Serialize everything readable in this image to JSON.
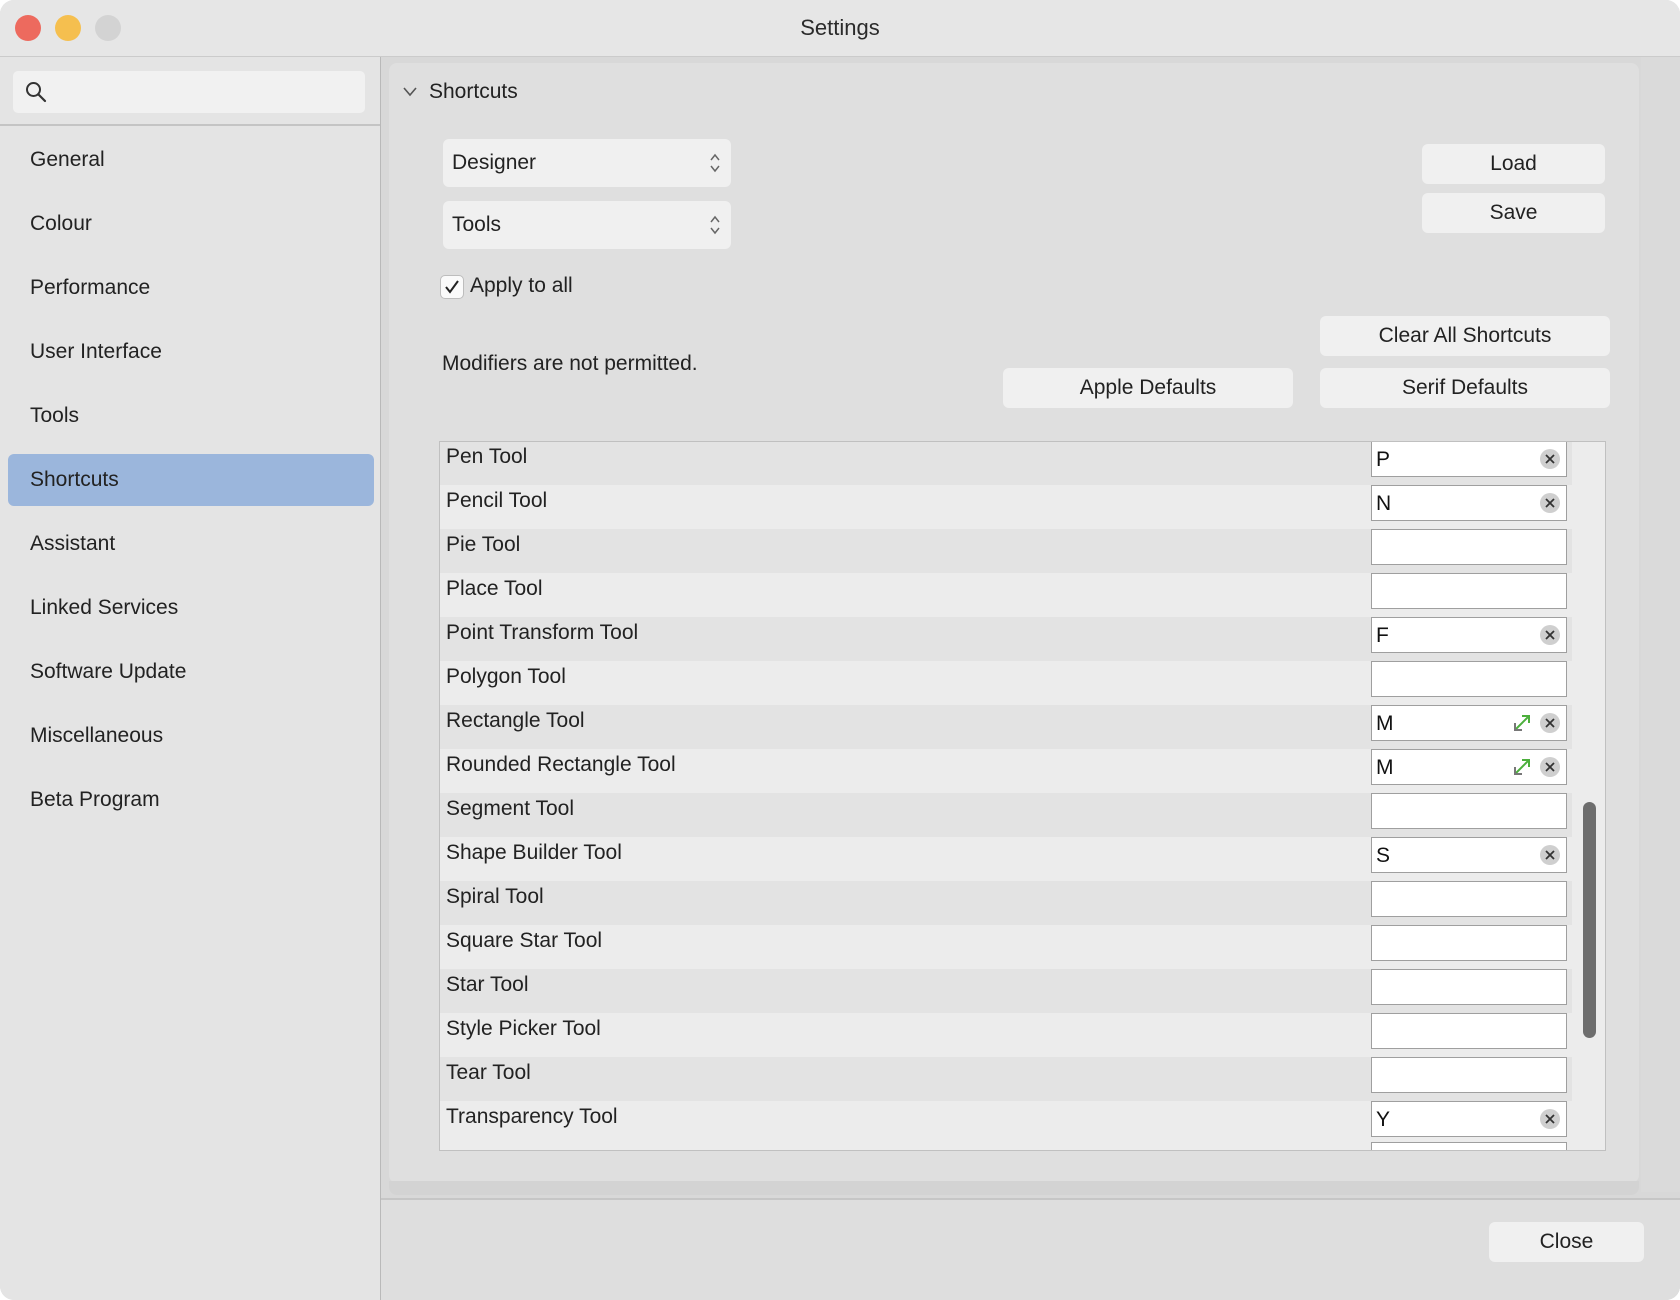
{
  "window": {
    "title": "Settings",
    "traffic_lights": {
      "close_color": "#ed6a5e",
      "minimize_color": "#f5bf4f",
      "zoom_color": "#d3d3d3"
    }
  },
  "sidebar": {
    "search": {
      "icon": "magnifier-icon",
      "value": "",
      "placeholder": ""
    },
    "selected_color": "#9bb6dc",
    "items": [
      {
        "label": "General"
      },
      {
        "label": "Colour"
      },
      {
        "label": "Performance"
      },
      {
        "label": "User Interface"
      },
      {
        "label": "Tools"
      },
      {
        "label": "Shortcuts",
        "selected": true
      },
      {
        "label": "Assistant"
      },
      {
        "label": "Linked Services"
      },
      {
        "label": "Software Update"
      },
      {
        "label": "Miscellaneous"
      },
      {
        "label": "Beta Program"
      }
    ]
  },
  "shortcuts": {
    "section_title": "Shortcuts",
    "app_popup": {
      "value": "Designer"
    },
    "category_popup": {
      "value": "Tools"
    },
    "load_label": "Load",
    "save_label": "Save",
    "apply_to_all": {
      "label": "Apply to all",
      "checked": true
    },
    "modifiers_note": "Modifiers are not permitted.",
    "clear_all_label": "Clear All Shortcuts",
    "apple_defaults_label": "Apple Defaults",
    "serif_defaults_label": "Serif Defaults",
    "rows": [
      {
        "name": "Pen Tool",
        "key": "P",
        "conflict": false
      },
      {
        "name": "Pencil Tool",
        "key": "N",
        "conflict": false
      },
      {
        "name": "Pie Tool",
        "key": "",
        "conflict": false
      },
      {
        "name": "Place Tool",
        "key": "",
        "conflict": false
      },
      {
        "name": "Point Transform Tool",
        "key": "F",
        "conflict": false
      },
      {
        "name": "Polygon Tool",
        "key": "",
        "conflict": false
      },
      {
        "name": "Rectangle Tool",
        "key": "M",
        "conflict": true
      },
      {
        "name": "Rounded Rectangle Tool",
        "key": "M",
        "conflict": true
      },
      {
        "name": "Segment Tool",
        "key": "",
        "conflict": false
      },
      {
        "name": "Shape Builder Tool",
        "key": "S",
        "conflict": false
      },
      {
        "name": "Spiral Tool",
        "key": "",
        "conflict": false
      },
      {
        "name": "Square Star Tool",
        "key": "",
        "conflict": false
      },
      {
        "name": "Star Tool",
        "key": "",
        "conflict": false
      },
      {
        "name": "Style Picker Tool",
        "key": "",
        "conflict": false
      },
      {
        "name": "Tear Tool",
        "key": "",
        "conflict": false
      },
      {
        "name": "Transparency Tool",
        "key": "Y",
        "conflict": false
      }
    ]
  },
  "footer": {
    "close_label": "Close"
  }
}
